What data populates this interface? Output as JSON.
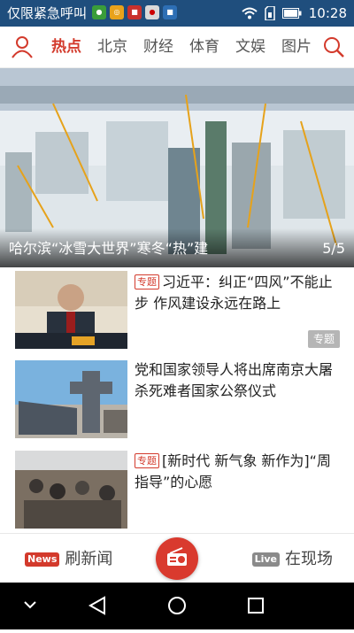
{
  "status_bar": {
    "text": "仅限紧急呼叫",
    "time": "10:28",
    "icons": [
      "wechat-icon",
      "browser-icon",
      "news-app-icon",
      "cnr-app-icon",
      "cbn-app-icon",
      "wifi-icon",
      "sim-icon",
      "battery-icon"
    ]
  },
  "nav": {
    "tabs": [
      {
        "label": "热点",
        "active": true
      },
      {
        "label": "北京"
      },
      {
        "label": "财经"
      },
      {
        "label": "体育"
      },
      {
        "label": "文娱"
      },
      {
        "label": "图片"
      }
    ],
    "accent_color": "#d33a2c"
  },
  "hero": {
    "title": "哈尔滨“冰雪大世界”寒冬“热”建",
    "counter": "5/5"
  },
  "articles": [
    {
      "tag": "专题",
      "title": "习近平：纠正“四风”不能止步 作风建设永远在路上",
      "badge": "专题"
    },
    {
      "title": "党和国家领导人将出席南京大屠杀死难者国家公祭仪式"
    },
    {
      "tag": "专题",
      "title": "[新时代 新气象 新作为]“周指导”的心愿"
    }
  ],
  "bottom_bar": {
    "news_badge": "News",
    "left_label": "刷新闻",
    "live_badge": "Live",
    "right_label": "在现场"
  }
}
